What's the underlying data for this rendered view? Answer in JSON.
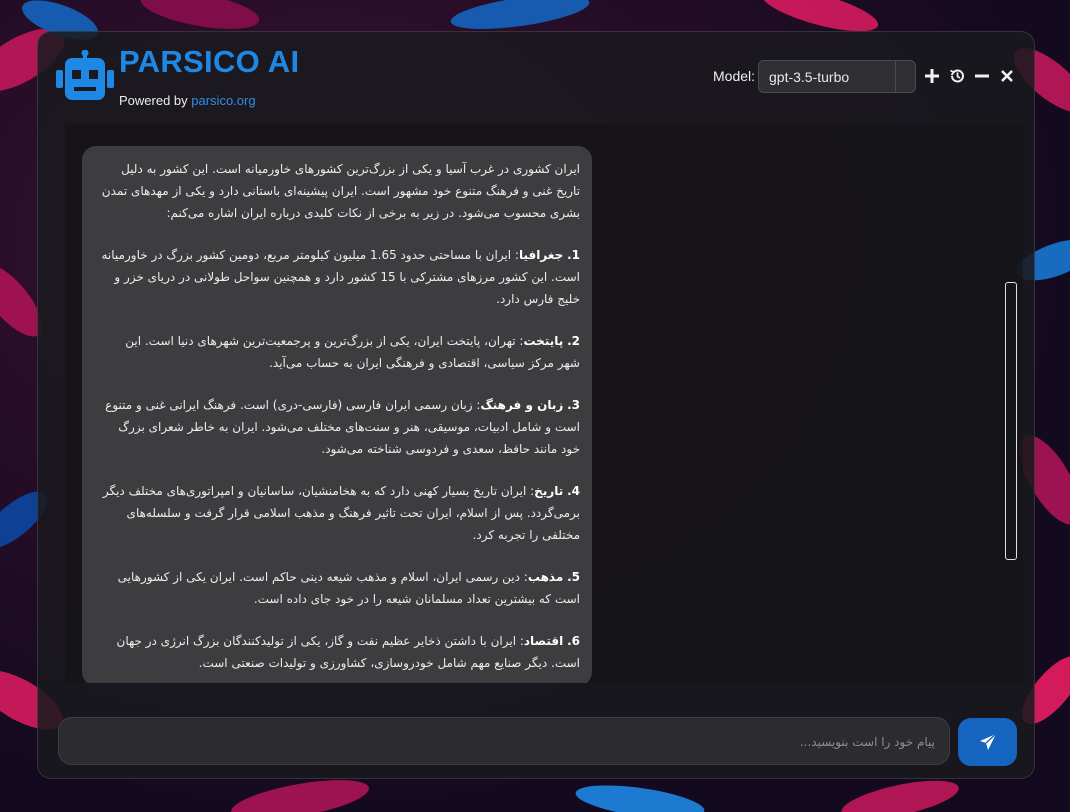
{
  "brand": {
    "title": "PARSICO AI",
    "powered_prefix": "Powered by ",
    "powered_link": "parsico.org",
    "accent_color": "#1e88e5"
  },
  "header": {
    "model_label": "Model:",
    "model_value": "gpt-3.5-turbo",
    "buttons": [
      "plus-icon",
      "history-icon",
      "minimize-icon",
      "close-icon"
    ]
  },
  "message": {
    "intro": "ایران کشوری در غرب آسیا و یکی از بزرگ‌ترین کشورهای خاورمیانه است. این کشور به دلیل تاریخ غنی و فرهنگ متنوع خود مشهور است. ایران پیشینه‌ای باستانی دارد و یکی از مهدهای تمدن بشری محسوب می‌شود. در زیر به برخی از نکات کلیدی درباره ایران اشاره می‌کنم:",
    "points": [
      {
        "num": "1.",
        "title": "جغرافیا",
        "text": ": ایران با مساحتی حدود 1.65 میلیون کیلومتر مربع، دومین کشور بزرگ در خاورمیانه است. این کشور مرزهای مشترکی با 15 کشور دارد و همچنین سواحل طولانی در دریای خزر و خلیج فارس دارد."
      },
      {
        "num": "2.",
        "title": "پایتخت",
        "text": ": تهران، پایتخت ایران، یکی از بزرگ‌ترین و پرجمعیت‌ترین شهرهای دنیا است. این شهر مرکز سیاسی، اقتصادی و فرهنگی ایران به حساب می‌آید."
      },
      {
        "num": "3.",
        "title": "زبان و فرهنگ",
        "text": ": زبان رسمی ایران فارسی (فارسی-دری) است. فرهنگ ایرانی غنی و متنوع است و شامل ادبیات، موسیقی، هنر و سنت‌های مختلف می‌شود. ایران به خاطر شعرای بزرگ خود مانند حافظ، سعدی و فردوسی شناخته می‌شود."
      },
      {
        "num": "4.",
        "title": "تاریخ",
        "text": ": ایران تاریخ بسیار کهنی دارد که به هخامنشیان، ساسانیان و امپراتوری‌های مختلف دیگر برمی‌گردد. پس از اسلام، ایران تحت تاثیر فرهنگ و مذهب اسلامی قرار گرفت و سلسله‌های مختلفی را تجربه کرد."
      },
      {
        "num": "5.",
        "title": "مذهب",
        "text": ": دین رسمی ایران، اسلام و مذهب شیعه دینی حاکم است. ایران یکی از کشورهایی است که بیشترین تعداد مسلمانان شیعه را در خود جای داده است."
      },
      {
        "num": "6.",
        "title": "اقتصاد",
        "text": ": ایران با داشتن ذخایر عظیم نفت و گاز، یکی از تولیدکنندگان بزرگ انرژی در جهان است. دیگر صنایع مهم شامل خودروسازی، کشاورزی و تولیدات صنعتی است."
      }
    ]
  },
  "composer": {
    "placeholder": "پیام خود را است بنویسید...",
    "value": "",
    "send_icon": "send-icon"
  }
}
